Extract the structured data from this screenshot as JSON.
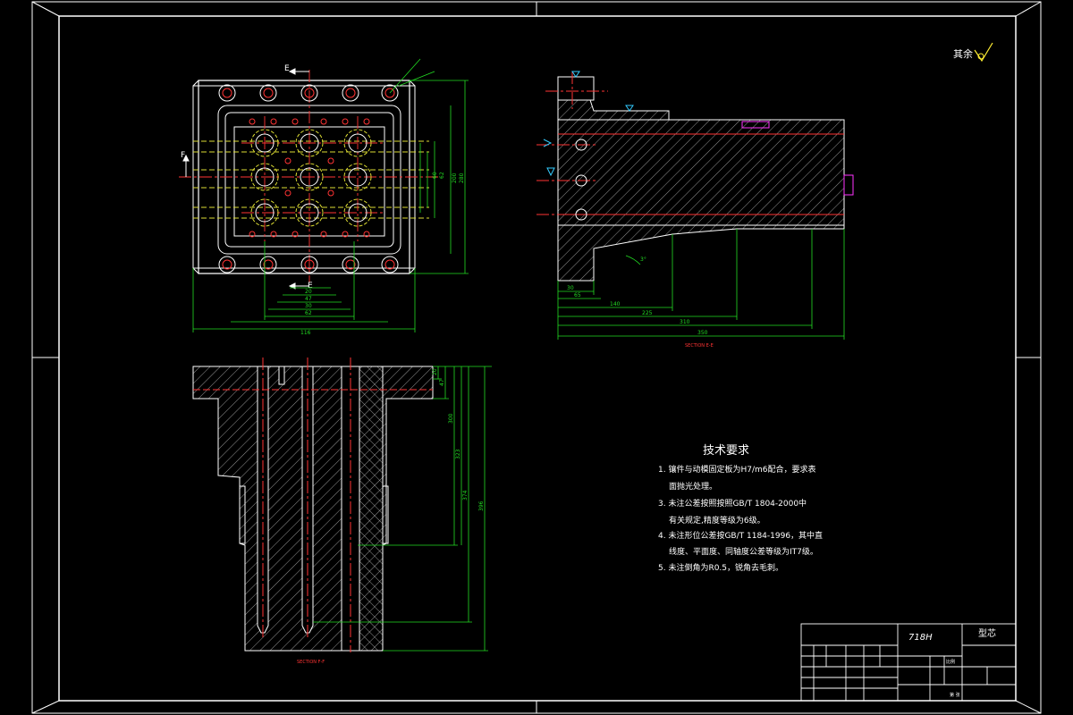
{
  "roughness_note": "其余",
  "tech_requirements": {
    "title": "技术要求",
    "lines": [
      "1. 镶件与动模固定板为H7/m6配合，要求表",
      "面抛光处理。",
      "3. 未注公差按照按照GB/T 1804-2000中",
      "有关规定,精度等级为6级。",
      "4. 未注形位公差按GB/T 1184-1996，其中直",
      "线度、平面度、同轴度公差等级为IT7级。",
      "5. 未注倒角为R0.5，锐角去毛刺。"
    ]
  },
  "section_labels": {
    "ee": "SECTION E-E",
    "ff": "SECTION F-F",
    "e_mark": "E",
    "f_mark": "F"
  },
  "dims": {
    "top_h": [
      "20",
      "47",
      "30",
      "62",
      "116"
    ],
    "top_v": [
      "60",
      "62",
      "200",
      "280"
    ],
    "ee": [
      "30",
      "65",
      "140",
      "225",
      "310",
      "350"
    ],
    "ee_angle": "3°",
    "ff": [
      "20",
      "47",
      "300",
      "323",
      "374",
      "396"
    ]
  },
  "title_block": {
    "material": "718H",
    "drawing_name": "型芯",
    "scale_label": "比例",
    "sheet_label": "第  张"
  },
  "colors": {
    "line": "#ffffff",
    "center": "#ff3333",
    "dim": "#22dd22",
    "hidden": "#dddd33",
    "hatch": "#cccccc",
    "note": "#ff33ff",
    "cyan": "#33ccff"
  }
}
